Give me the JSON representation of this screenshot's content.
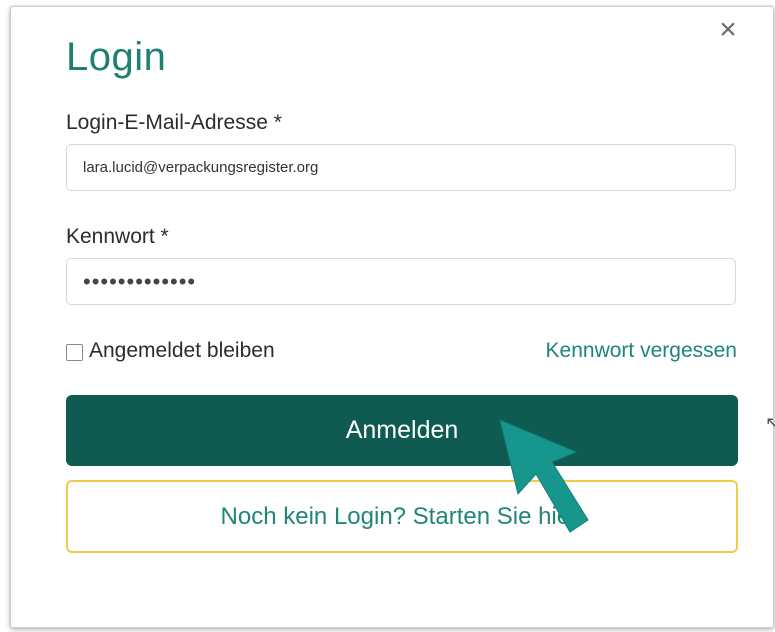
{
  "dialog": {
    "title": "Login",
    "close_icon": "close-icon",
    "close_glyph": "×"
  },
  "email": {
    "label": "Login-E-Mail-Adresse *",
    "value": "lara.lucid@verpackungsregister.org"
  },
  "password": {
    "label": "Kennwort *",
    "value": "•••••••••••••"
  },
  "remember": {
    "label": "Angemeldet bleiben",
    "checked": false
  },
  "forgot_link": "Kennwort vergessen",
  "submit_label": "Anmelden",
  "register_label": "Noch kein Login? Starten Sie hier.",
  "colors": {
    "accent": "#1f7f72",
    "primary_button": "#0f5b52",
    "register_border": "#eccc4a",
    "pointer_arrow": "#16968c"
  },
  "overlay": {
    "pointer_icon": "pointer-arrow-icon",
    "edge_arrow_icon": "left-arrow-icon"
  }
}
